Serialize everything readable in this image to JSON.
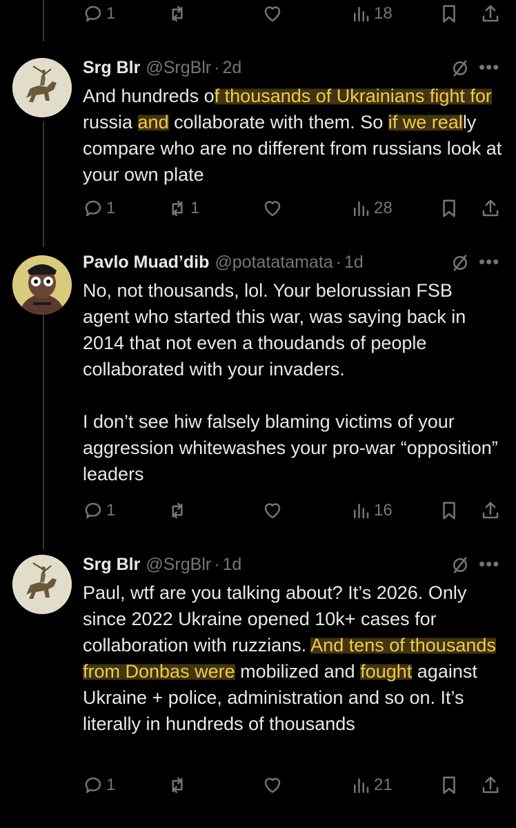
{
  "top_actions": {
    "replies": "1",
    "reposts": "",
    "likes": "",
    "views": "18"
  },
  "tweets": [
    {
      "name": "Srg Blr",
      "handle": "@SrgBlr",
      "sep": "·",
      "time": "2d",
      "body": [
        {
          "plain": "And hundreds o"
        },
        {
          "hl": "f thousands of Ukrainians fight for"
        },
        {
          "plain": " russia "
        },
        {
          "hl": "and"
        },
        {
          "plain": " collaborate with them. So "
        },
        {
          "hl": "if we real"
        },
        {
          "plain": "ly compare who are no different from russians look at your own plate"
        }
      ],
      "actions": {
        "replies": "1",
        "reposts": "1",
        "likes": "",
        "views": "28"
      }
    },
    {
      "name": "Pavlo Muad’dib",
      "handle": "@potatatamata",
      "sep": "·",
      "time": "1d",
      "paragraphs": [
        "No, not thousands, lol. Your belorussian FSB agent who started this war, was saying back in 2014 that not even a thoudands of people collaborated with your invaders.",
        "I don’t see hiw falsely blaming victims of your aggression whitewashes your pro-war “opposition” leaders"
      ],
      "actions": {
        "replies": "1",
        "reposts": "",
        "likes": "",
        "views": "16"
      }
    },
    {
      "name": "Srg Blr",
      "handle": "@SrgBlr",
      "sep": "·",
      "time": "1d",
      "body": [
        {
          "plain": "Paul, wtf are you talking about? It’s 2026. Only since 2022 Ukraine opened 10k+ cases for collaboration with ruzzians. "
        },
        {
          "hl": "And tens of thousands from Donbas were"
        },
        {
          "plain": " mobilized and "
        },
        {
          "hl": "fought"
        },
        {
          "plain": " against Ukraine + police, administration and so on. It’s literally in hundreds of thousands"
        }
      ],
      "actions": {
        "replies": "1",
        "reposts": "",
        "likes": "",
        "views": "21"
      }
    }
  ],
  "colors": {
    "background": "#000000",
    "text": "#e7e9ea",
    "muted": "#71767b",
    "highlight": "#f2c94c",
    "thread": "#333639"
  }
}
